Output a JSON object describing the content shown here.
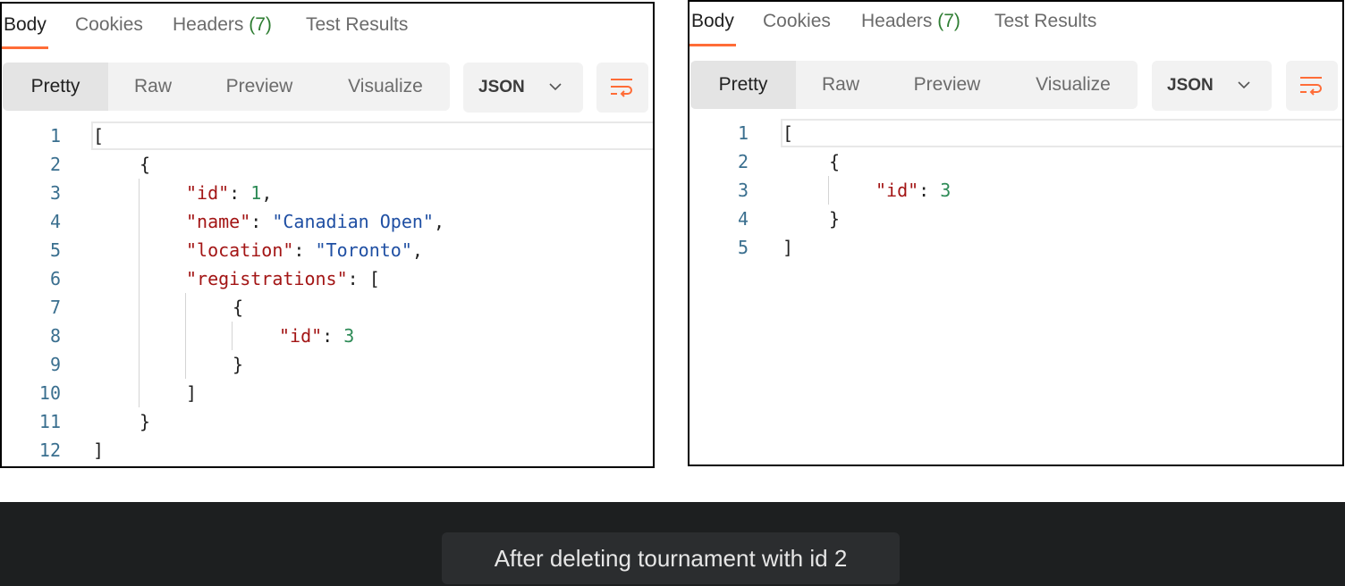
{
  "tabs": [
    {
      "label": "Body"
    },
    {
      "label": "Cookies"
    },
    {
      "label": "Headers",
      "count": "(7)"
    },
    {
      "label": "Test Results"
    }
  ],
  "modes": [
    "Pretty",
    "Raw",
    "Preview",
    "Visualize"
  ],
  "format": "JSON",
  "accent_color": "#ff6c37",
  "left_editor": {
    "line_numbers": [
      "1",
      "2",
      "3",
      "4",
      "5",
      "6",
      "7",
      "8",
      "9",
      "10",
      "11",
      "12"
    ]
  },
  "right_editor": {
    "line_numbers": [
      "1",
      "2",
      "3",
      "4",
      "5"
    ]
  },
  "caption": "After deleting tournament with id 2"
}
